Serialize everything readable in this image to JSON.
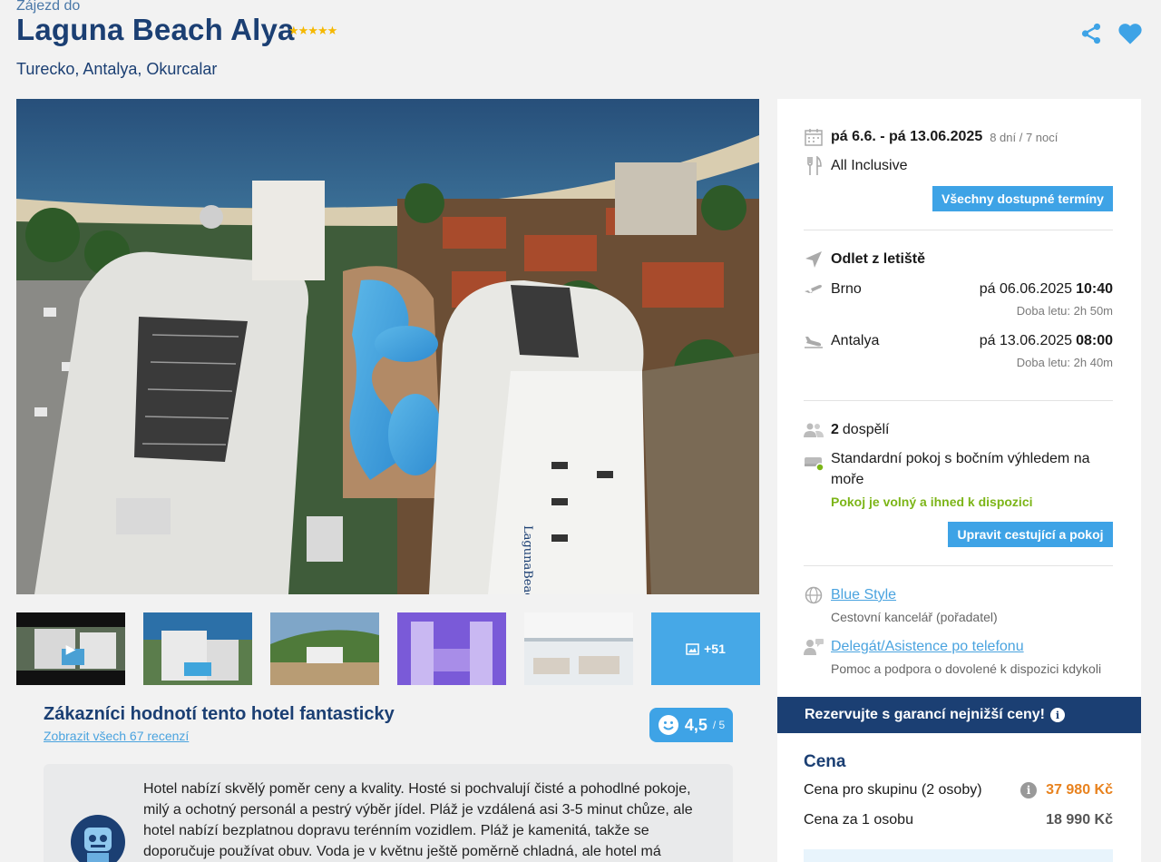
{
  "header": {
    "eyebrow": "Zájezd do",
    "title": "Laguna Beach Alya",
    "stars": "★★★★★",
    "location": "Turecko, Antalya, Okurcalar"
  },
  "gallery": {
    "more_label": "+51"
  },
  "review": {
    "title": "Zákazníci hodnotí tento hotel fantasticky",
    "link": "Zobrazit všech 67 recenzí",
    "score": "4,5",
    "score_max": "/ 5",
    "summary": "Hotel nabízí skvělý poměr ceny a kvality. Hosté si pochvalují čisté a pohodlné pokoje, milý a ochotný personál a pestrý výběr jídel. Pláž je vzdálená asi 3-5 minut chůze, ale hotel nabízí bezplatnou dopravu terénním vozidlem. Pláž je kamenitá, takže se doporučuje používat obuv. Voda je v květnu ještě poměrně chladná, ale hotel má vlastní"
  },
  "sidebar": {
    "dates": "pá 6.6. - pá 13.06.2025",
    "duration": "8 dní / 7 nocí",
    "board": "All Inclusive",
    "all_dates_button": "Všechny dostupné termíny",
    "departure_heading": "Odlet z letiště",
    "flights": [
      {
        "airport": "Brno",
        "date": "pá 06.06.2025",
        "time": "10:40",
        "duration": "Doba letu: 2h 50m"
      },
      {
        "airport": "Antalya",
        "date": "pá 13.06.2025",
        "time": "08:00",
        "duration": "Doba letu: 2h 40m"
      }
    ],
    "adults_count": "2",
    "adults_label": "dospělí",
    "room": "Standardní pokoj s bočním výhledem na moře",
    "availability": "Pokoj je volný a ihned k dispozici",
    "edit_button": "Upravit cestující a pokoj",
    "agency_link": "Blue Style",
    "agency_desc": "Cestovní kancelář (pořadatel)",
    "delegate_link": "Delegát/Asistence po telefonu",
    "delegate_desc": "Pomoc a podpora o dovolené k dispozici kdykoli"
  },
  "booking": {
    "banner": "Rezervujte s garancí nejnižší ceny!",
    "price_heading": "Cena",
    "group_label": "Cena pro skupinu (2 osoby)",
    "group_price": "37 980 Kč",
    "person_label": "Cena za 1 osobu",
    "person_price": "18 990 Kč"
  },
  "colors": {
    "brand_navy": "#1b3f73",
    "accent_blue": "#3ea3e6",
    "price_orange": "#e8821e",
    "available_green": "#7cb518"
  }
}
